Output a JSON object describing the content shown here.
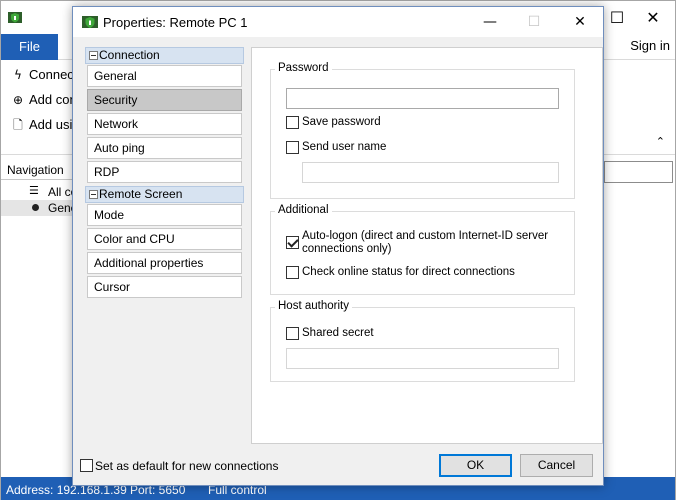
{
  "background_app": {
    "file_tab": "File",
    "sign_in": "Sign in",
    "commands": [
      {
        "label": "Connect",
        "icon": "lightning-icon"
      },
      {
        "label": "Add con",
        "icon": "add-circle-icon"
      },
      {
        "label": "Add usin",
        "icon": "document-icon"
      }
    ],
    "navigation_label": "Navigation",
    "tree_items": [
      {
        "label": "All co",
        "icon": "list-icon"
      },
      {
        "label": "Gene",
        "icon": "dot-icon"
      }
    ],
    "status": {
      "address": "Address: 192.168.1.39",
      "port": "Port: 5650",
      "mode": "Full control"
    }
  },
  "dialog": {
    "title": "Properties: Remote PC 1",
    "nav_groups": [
      {
        "title": "Connection",
        "items": [
          "General",
          "Security",
          "Network",
          "Auto ping",
          "RDP"
        ]
      },
      {
        "title": "Remote Screen",
        "items": [
          "Mode",
          "Color and CPU",
          "Additional properties",
          "Cursor"
        ]
      }
    ],
    "active_item": "Security",
    "password_group": {
      "title": "Password",
      "password_value": "",
      "save_password": {
        "label": "Save password",
        "checked": false
      },
      "send_user_name": {
        "label": "Send user name",
        "checked": false
      },
      "user_name_value": ""
    },
    "additional_group": {
      "title": "Additional",
      "auto_logon": {
        "label_line1": "Auto-logon (direct and custom Internet-ID server",
        "label_line2": "connections only)",
        "checked": true
      },
      "check_online": {
        "label": "Check online status for direct connections",
        "checked": false
      }
    },
    "host_authority_group": {
      "title": "Host authority",
      "shared_secret": {
        "label": "Shared secret",
        "checked": false
      },
      "secret_value": ""
    },
    "footer": {
      "set_default": {
        "label": "Set as default for new connections",
        "checked": false
      },
      "ok_label": "OK",
      "cancel_label": "Cancel"
    }
  },
  "colors": {
    "accent": "#1f5fb5",
    "group_header": "#d7e3f1",
    "default_button_border": "#0078d7"
  }
}
